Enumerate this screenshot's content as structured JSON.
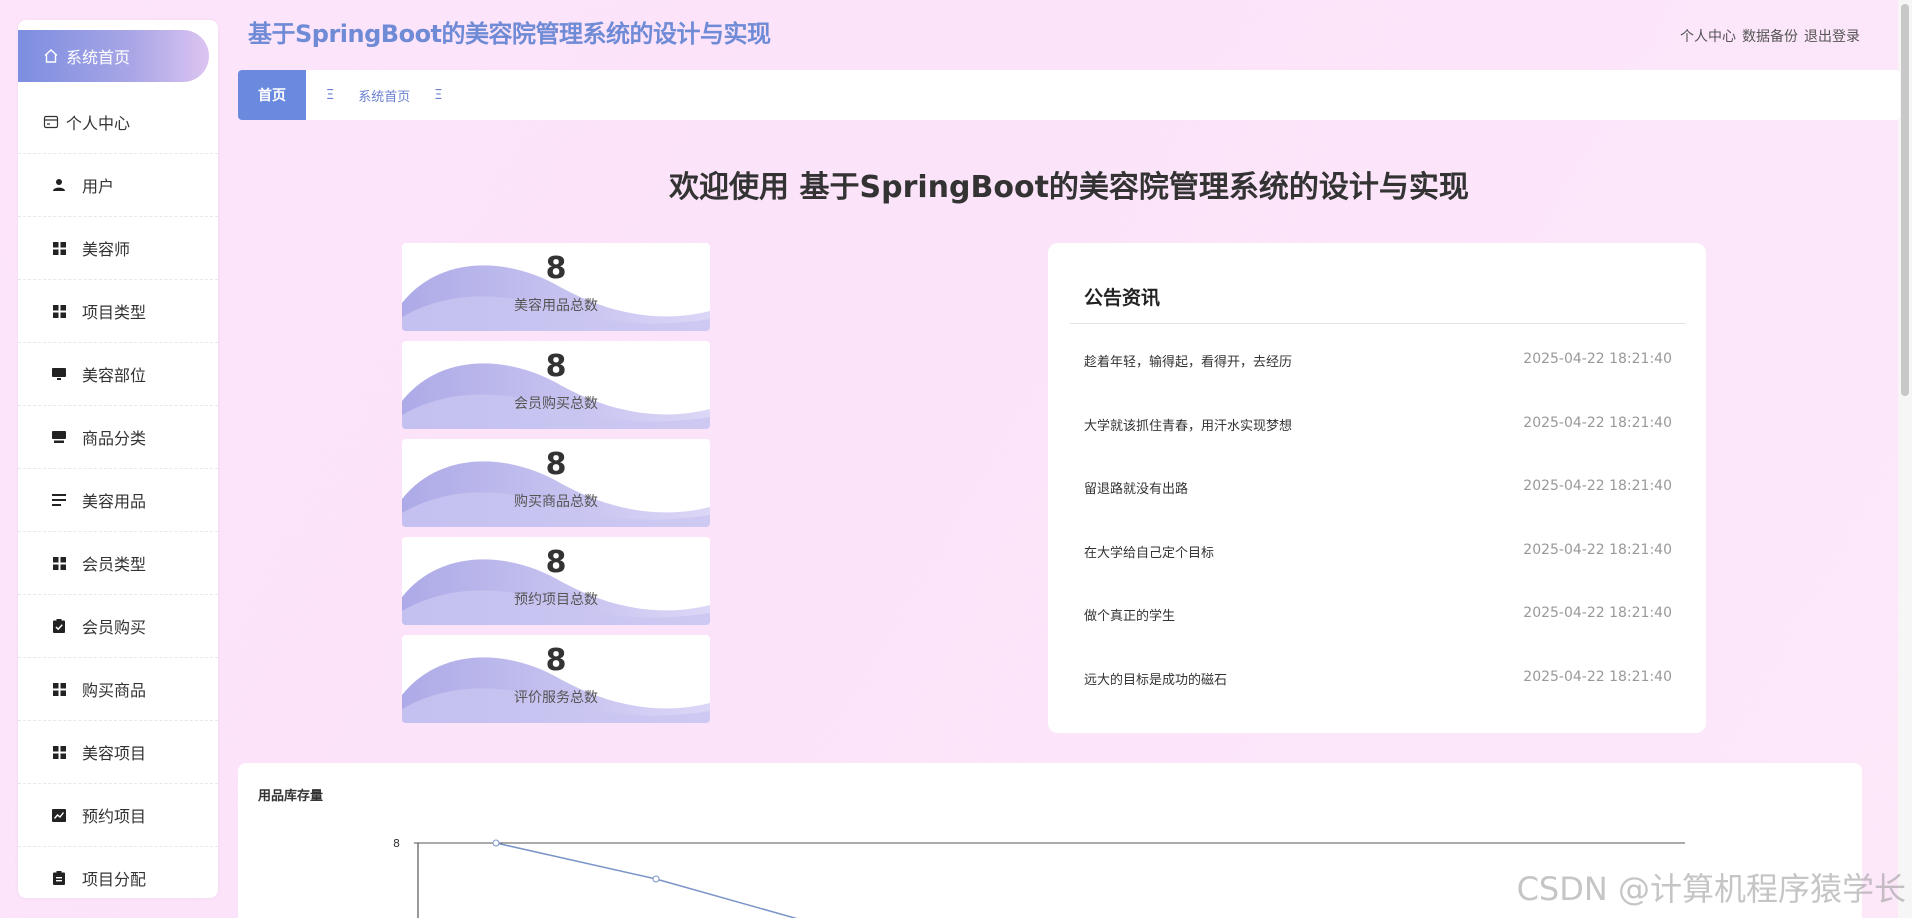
{
  "header": {
    "title": "基于SpringBoot的美容院管理系统的设计与实现",
    "links": [
      "个人中心",
      "数据备份",
      "退出登录"
    ]
  },
  "sidebar": {
    "items": [
      {
        "label": "系统首页",
        "icon": "home-icon"
      },
      {
        "label": "个人中心",
        "icon": "card-icon"
      },
      {
        "label": "用户",
        "icon": "user-icon"
      },
      {
        "label": "美容师",
        "icon": "grid-icon"
      },
      {
        "label": "项目类型",
        "icon": "grid-icon"
      },
      {
        "label": "美容部位",
        "icon": "monitor-icon"
      },
      {
        "label": "商品分类",
        "icon": "stack-icon"
      },
      {
        "label": "美容用品",
        "icon": "list-icon"
      },
      {
        "label": "会员类型",
        "icon": "grid-icon"
      },
      {
        "label": "会员购买",
        "icon": "clipboard-check-icon"
      },
      {
        "label": "购买商品",
        "icon": "grid-icon"
      },
      {
        "label": "美容项目",
        "icon": "grid-icon"
      },
      {
        "label": "预约项目",
        "icon": "chart-icon"
      },
      {
        "label": "项目分配",
        "icon": "clipboard-icon"
      }
    ]
  },
  "tabs": {
    "home": "首页",
    "crumb_sep": "Ξ",
    "crumb": "系统首页"
  },
  "welcome": "欢迎使用 基于SpringBoot的美容院管理系统的设计与实现",
  "stats": [
    {
      "value": "8",
      "label": "美容用品总数"
    },
    {
      "value": "8",
      "label": "会员购买总数"
    },
    {
      "value": "8",
      "label": "购买商品总数"
    },
    {
      "value": "8",
      "label": "预约项目总数"
    },
    {
      "value": "8",
      "label": "评价服务总数"
    }
  ],
  "notice": {
    "title": "公告资讯",
    "items": [
      {
        "title": "趁着年轻，输得起，看得开，去经历",
        "date": "2025-04-22 18:21:40"
      },
      {
        "title": "大学就该抓住青春，用汗水实现梦想",
        "date": "2025-04-22 18:21:40"
      },
      {
        "title": "留退路就没有出路",
        "date": "2025-04-22 18:21:40"
      },
      {
        "title": "在大学给自己定个目标",
        "date": "2025-04-22 18:21:40"
      },
      {
        "title": "做个真正的学生",
        "date": "2025-04-22 18:21:40"
      },
      {
        "title": "远大的目标是成功的磁石",
        "date": "2025-04-22 18:21:40"
      }
    ]
  },
  "chart_data": {
    "type": "line",
    "title": "用品库存量",
    "y_tick_labels": [
      "8"
    ],
    "series": [
      {
        "values": [
          8,
          7.6,
          7.1
        ]
      }
    ]
  },
  "watermark": "CSDN @计算机程序猿学长",
  "colors": {
    "accent": "#6a8adf",
    "title": "#6f8bd6",
    "background": "#fde6fb",
    "line": "#7a94c8"
  }
}
